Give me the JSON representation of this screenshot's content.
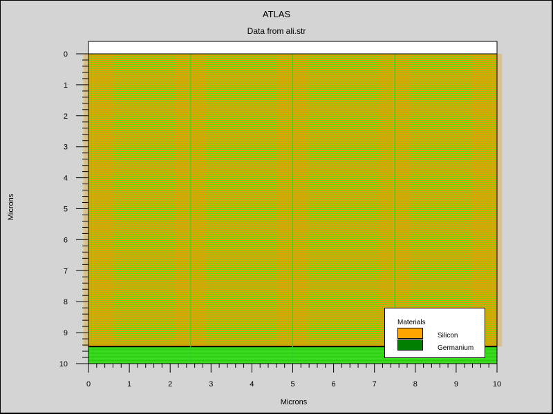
{
  "chart_data": {
    "type": "heatmap",
    "title": "ATLAS",
    "subtitle": "Data from ali.str",
    "xlabel": "Microns",
    "ylabel": "Microns",
    "xlim": [
      0,
      10
    ],
    "ylim": [
      0,
      10
    ],
    "y_inverted": true,
    "x_ticks": [
      "0",
      "1",
      "2",
      "3",
      "4",
      "5",
      "6",
      "7",
      "8",
      "9",
      "10"
    ],
    "y_ticks": [
      "0",
      "1",
      "2",
      "3",
      "4",
      "5",
      "6",
      "7",
      "8",
      "9",
      "10"
    ],
    "grid": false,
    "legend_position": "bottom-right",
    "legend": {
      "title": "Materials",
      "entries": [
        {
          "name": "Silicon",
          "color": "#ffa500"
        },
        {
          "name": "Germanium",
          "color": "#008000"
        }
      ]
    },
    "regions": [
      {
        "material": "Silicon",
        "x_range": [
          0,
          10
        ],
        "y_range": [
          0,
          9.45
        ]
      },
      {
        "material": "Germanium",
        "x_range": [
          0,
          10
        ],
        "y_range": [
          9.45,
          10
        ]
      }
    ],
    "vertical_lines_x": [
      2.5,
      5.0,
      7.5
    ],
    "colors": {
      "silicon": "#ffa500",
      "germanium": "#008000",
      "mesh_light": "#44ee22",
      "mesh_orange": "#e3a000",
      "background": "#d4d4d4"
    }
  }
}
